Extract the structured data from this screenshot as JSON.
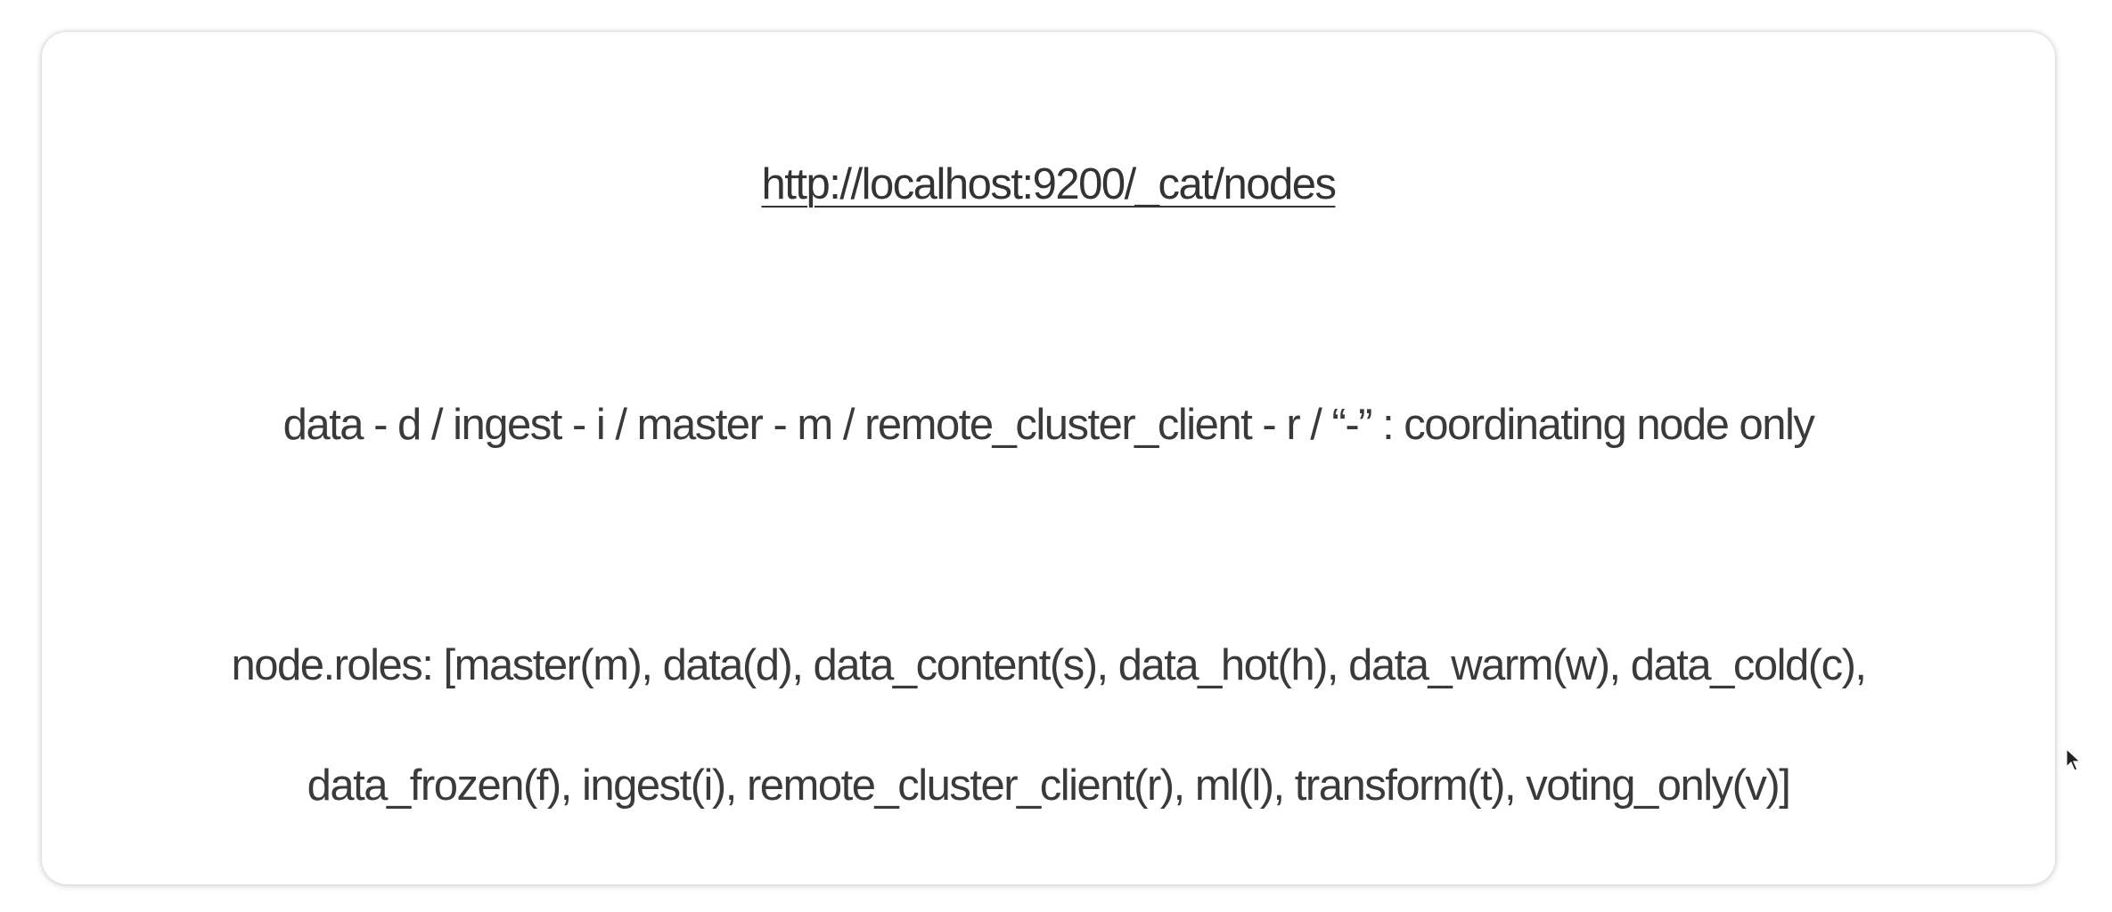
{
  "slide": {
    "url": "http://localhost:9200/_cat/nodes",
    "roles_legend": "data - d / ingest - i / master - m / remote_cluster_client - r / “-” : coordinating node only",
    "node_roles_line1": "node.roles: [master(m), data(d), data_content(s), data_hot(h), data_warm(w), data_cold(c),",
    "node_roles_line2": "data_frozen(f), ingest(i), remote_cluster_client(r), ml(l), transform(t), voting_only(v)]"
  },
  "icons": {
    "cursor": "mouse-pointer-icon"
  }
}
